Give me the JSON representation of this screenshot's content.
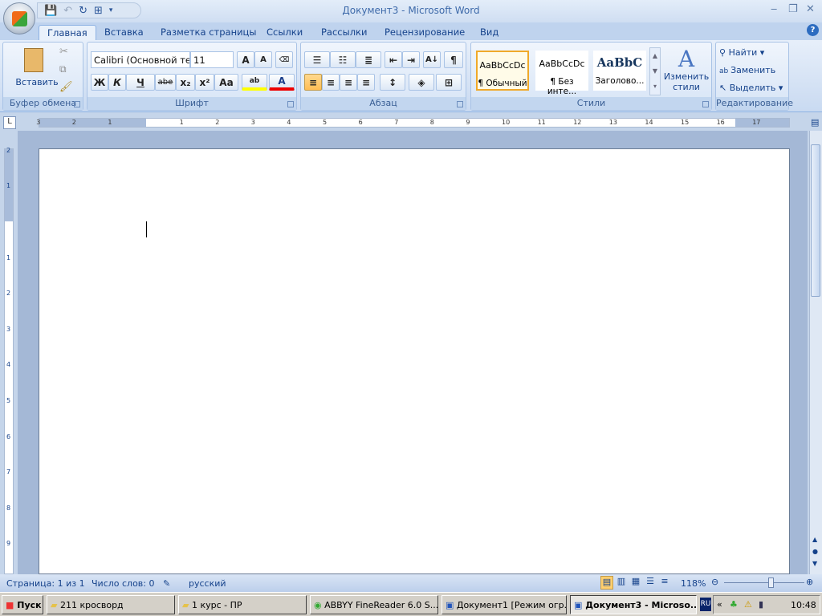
{
  "window": {
    "title": "Документ3 - Microsoft Word"
  },
  "tabs": [
    "Главная",
    "Вставка",
    "Разметка страницы",
    "Ссылки",
    "Рассылки",
    "Рецензирование",
    "Вид"
  ],
  "ribbon": {
    "clipboard": {
      "label": "Буфер обмена",
      "paste": "Вставить"
    },
    "font": {
      "label": "Шрифт",
      "font_name": "Calibri (Основной те",
      "font_size": "11",
      "bold": "Ж",
      "italic": "К",
      "underline": "Ч",
      "strike": "abe",
      "sub": "x₂",
      "sup": "x²",
      "case": "Aa",
      "grow": "A",
      "shrink": "A",
      "color_letter": "A",
      "highlight": "ab"
    },
    "paragraph": {
      "label": "Абзац",
      "pilcrow": "¶"
    },
    "styles": {
      "label": "Стили",
      "items": [
        {
          "sample": "AaBbCcDc",
          "name": "¶ Обычный"
        },
        {
          "sample": "AaBbCcDc",
          "name": "¶ Без инте..."
        },
        {
          "sample": "AaBbC",
          "name": "Заголово..."
        }
      ],
      "change": "Изменить стили"
    },
    "editing": {
      "label": "Редактирование",
      "find": "Найти",
      "replace": "Заменить",
      "select": "Выделить"
    }
  },
  "ruler": {
    "h_left": [
      "3",
      "2",
      "1"
    ],
    "h_right": [
      "1",
      "2",
      "3",
      "4",
      "5",
      "6",
      "7",
      "8",
      "9",
      "10",
      "11",
      "12",
      "13",
      "14",
      "15",
      "16",
      "17"
    ],
    "v_top": [
      "2",
      "1"
    ],
    "v": [
      "1",
      "2",
      "3",
      "4",
      "5",
      "6",
      "7",
      "8",
      "9"
    ]
  },
  "status": {
    "page": "Страница: 1 из 1",
    "words": "Число слов: 0",
    "lang": "русский",
    "zoom": "118%",
    "zoom_level": 0.59
  },
  "taskbar": {
    "start": "Пуск",
    "tasks": [
      "211 кросворд",
      "1 курс - ПР",
      "ABBYY FineReader 6.0 S...",
      "Документ1 [Режим огр...",
      "Документ3 - Microso..."
    ],
    "lang": "RU",
    "clock": "10:48"
  }
}
